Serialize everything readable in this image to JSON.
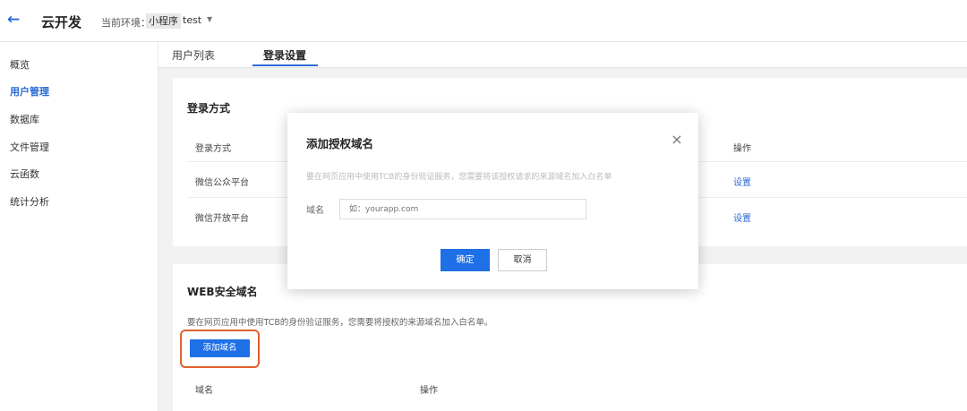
{
  "header": {
    "title": "云开发",
    "env_label": "当前环境：",
    "env_tag": "小程序",
    "env_name": "test",
    "caret": "▼",
    "back_glyph": "←"
  },
  "sidebar": {
    "items": [
      {
        "label": "概览"
      },
      {
        "label": "用户管理"
      },
      {
        "label": "数据库"
      },
      {
        "label": "文件管理"
      },
      {
        "label": "云函数"
      },
      {
        "label": "统计分析"
      }
    ]
  },
  "tabs": [
    {
      "label": "用户列表"
    },
    {
      "label": "登录设置"
    }
  ],
  "login_card": {
    "title": "登录方式",
    "columns": [
      "登录方式",
      "操作"
    ],
    "rows": [
      {
        "method": "微信公众平台",
        "action": "设置"
      },
      {
        "method": "微信开放平台",
        "action": "设置"
      }
    ]
  },
  "web_card": {
    "title": "WEB安全域名",
    "description": "要在网页应用中使用TCB的身份验证服务，您需要将授权的来源域名加入白名单。",
    "add_button": "添加域名",
    "columns": [
      "域名",
      "操作"
    ]
  },
  "modal": {
    "title": "添加授权域名",
    "close_glyph": "×",
    "description": "要在网页应用中使用TCB的身份验证服务，您需要将该授权请求的来源域名加入白名单",
    "field_label": "域名",
    "placeholder": "如：yourapp.com",
    "ok": "确定",
    "cancel": "取消"
  },
  "colors": {
    "accent": "#1f6fe6",
    "highlight_border": "#e0622e",
    "page_bg": "#f2f2f2"
  }
}
